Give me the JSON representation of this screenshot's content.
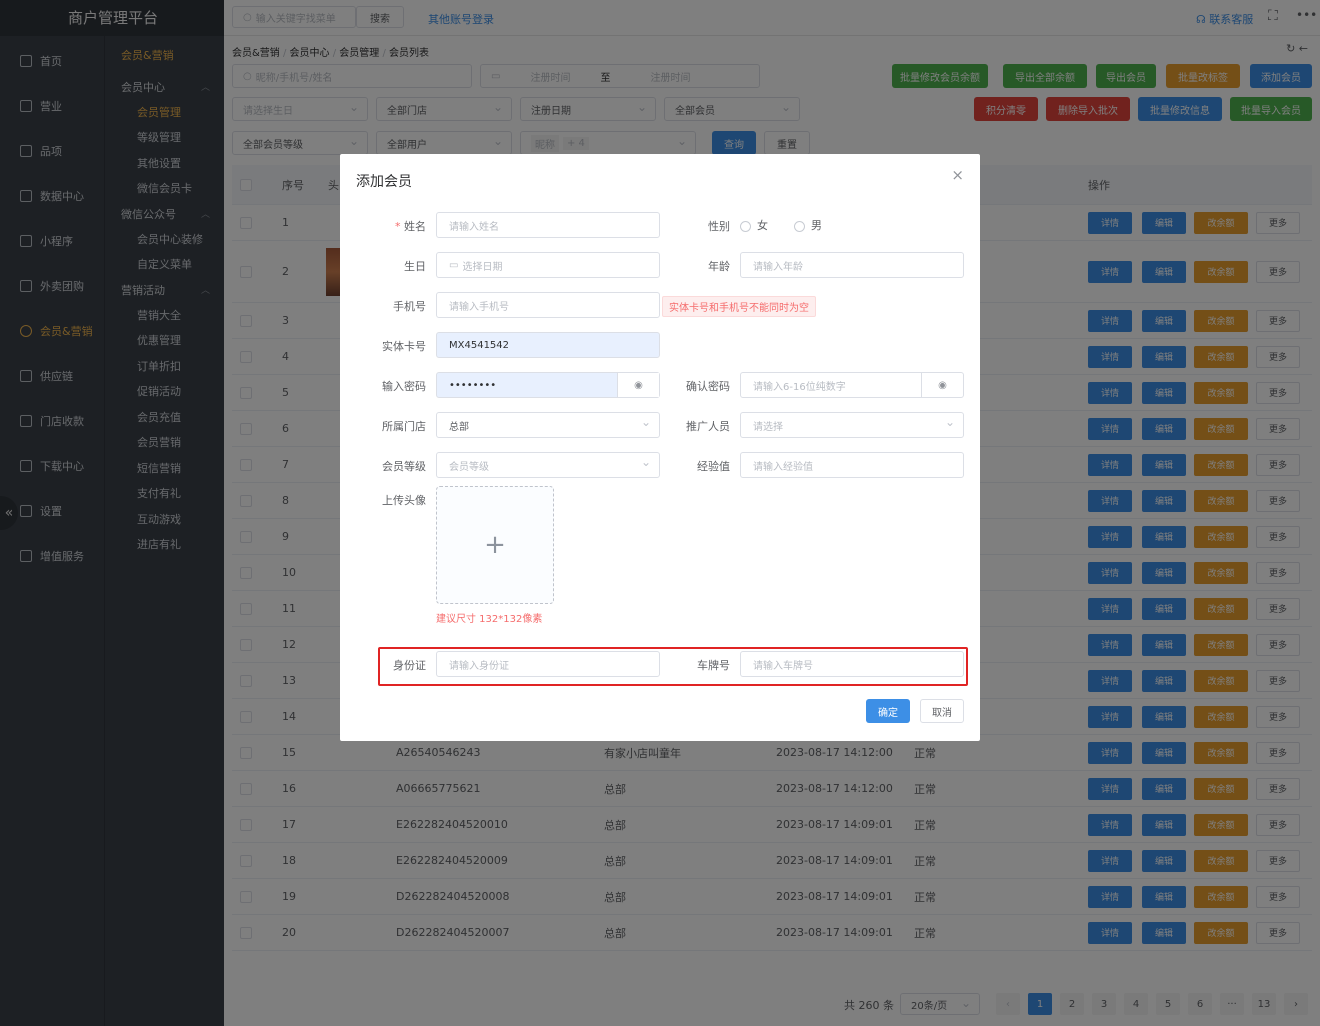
{
  "app": {
    "title": "商户管理平台"
  },
  "topbar": {
    "search_placeholder": "输入关键字找菜单",
    "search_btn": "搜索",
    "other_login": "其他账号登录",
    "contact": "联系客服"
  },
  "sidebar": {
    "items": [
      {
        "label": "首页",
        "icon": "home-icon"
      },
      {
        "label": "营业",
        "icon": "calendar-icon"
      },
      {
        "label": "品项",
        "icon": "bag-icon"
      },
      {
        "label": "数据中心",
        "icon": "share-icon"
      },
      {
        "label": "小程序",
        "icon": "phone-icon"
      },
      {
        "label": "外卖团购",
        "icon": "group-icon"
      },
      {
        "label": "会员&营销",
        "icon": "user-icon",
        "active": true
      },
      {
        "label": "供应链",
        "icon": "truck-icon"
      },
      {
        "label": "门店收款",
        "icon": "database-icon"
      },
      {
        "label": "下载中心",
        "icon": "download-icon"
      },
      {
        "label": "设置",
        "icon": "gear-icon"
      },
      {
        "label": "增值服务",
        "icon": "clock-icon"
      }
    ]
  },
  "subnav": {
    "title": "会员&营销",
    "groups": [
      {
        "label": "会员中心",
        "items": [
          "会员管理",
          "等级管理",
          "其他设置",
          "微信会员卡"
        ]
      },
      {
        "label": "微信公众号",
        "items": [
          "会员中心装修",
          "自定义菜单"
        ]
      },
      {
        "label": "营销活动",
        "items": [
          "营销大全",
          "优惠管理",
          "订单折扣",
          "促销活动",
          "会员充值",
          "会员营销",
          "短信营销",
          "支付有礼",
          "互动游戏",
          "进店有礼"
        ]
      }
    ]
  },
  "breadcrumb": [
    "会员&营销",
    "会员中心",
    "会员管理",
    "会员列表"
  ],
  "filters": {
    "search_placeholder": "昵称/手机号/姓名",
    "date_start": "注册时间",
    "date_sep": "至",
    "date_end": "注册时间",
    "birthday": "请选择生日",
    "store": "全部门店",
    "reg_date": "注册日期",
    "member": "全部会员",
    "level": "全部会员等级",
    "users": "全部用户",
    "nick": "昵称",
    "nick_more": "+ 4",
    "query": "查询",
    "reset": "重置"
  },
  "actions": {
    "row1": [
      "批量修改会员余额",
      "导出全部余额",
      "导出会员",
      "批量改标签",
      "添加会员"
    ],
    "row2": [
      "积分清零",
      "删除导入批次",
      "批量修改信息",
      "批量导入会员"
    ]
  },
  "table": {
    "headers": {
      "index": "序号",
      "avatar": "头",
      "ops": "操作"
    },
    "op_labels": [
      "详情",
      "编辑",
      "改余额",
      "更多"
    ],
    "rows": [
      {
        "i": "1"
      },
      {
        "i": "2"
      },
      {
        "i": "3"
      },
      {
        "i": "4"
      },
      {
        "i": "5"
      },
      {
        "i": "6"
      },
      {
        "i": "7"
      },
      {
        "i": "8"
      },
      {
        "i": "9"
      },
      {
        "i": "10"
      },
      {
        "i": "11"
      },
      {
        "i": "12"
      },
      {
        "i": "13"
      },
      {
        "i": "14"
      },
      {
        "i": "15",
        "card": "A26540546243",
        "store": "有家小店叫童年",
        "time": "2023-08-17 14:12:00",
        "status": "正常"
      },
      {
        "i": "16",
        "card": "A06665775621",
        "store": "总部",
        "time": "2023-08-17 14:12:00",
        "status": "正常"
      },
      {
        "i": "17",
        "card": "E262282404520010",
        "store": "总部",
        "time": "2023-08-17 14:09:01",
        "status": "正常"
      },
      {
        "i": "18",
        "card": "E262282404520009",
        "store": "总部",
        "time": "2023-08-17 14:09:01",
        "status": "正常"
      },
      {
        "i": "19",
        "card": "D262282404520008",
        "store": "总部",
        "time": "2023-08-17 14:09:01",
        "status": "正常"
      },
      {
        "i": "20",
        "card": "D262282404520007",
        "store": "总部",
        "time": "2023-08-17 14:09:01",
        "status": "正常"
      }
    ]
  },
  "pagination": {
    "total": "共 260 条",
    "size": "20条/页",
    "pages": [
      "1",
      "2",
      "3",
      "4",
      "5",
      "6",
      "···",
      "13"
    ],
    "current": "1"
  },
  "modal": {
    "title": "添加会员",
    "name_label": "姓名",
    "name_ph": "请输入姓名",
    "gender_label": "性别",
    "female": "女",
    "male": "男",
    "birthday_label": "生日",
    "birthday_ph": "选择日期",
    "age_label": "年龄",
    "age_ph": "请输入年龄",
    "phone_label": "手机号",
    "phone_ph": "请输入手机号",
    "phone_error": "实体卡号和手机号不能同时为空",
    "card_label": "实体卡号",
    "card_value": "MX4541542",
    "pwd_label": "输入密码",
    "pwd_value": "••••••••",
    "confirm_label": "确认密码",
    "confirm_ph": "请输入6-16位纯数字",
    "store_label": "所属门店",
    "store_value": "总部",
    "promoter_label": "推广人员",
    "promoter_ph": "请选择",
    "level_label": "会员等级",
    "level_ph": "会员等级",
    "exp_label": "经验值",
    "exp_ph": "请输入经验值",
    "avatar_label": "上传头像",
    "avatar_hint": "建议尺寸 132*132像素",
    "id_label": "身份证",
    "id_ph": "请输入身份证",
    "plate_label": "车牌号",
    "plate_ph": "请输入车牌号",
    "ok": "确定",
    "cancel": "取消"
  },
  "colors": {
    "accent": "#3d8fe6",
    "highlight": "#e02424",
    "active_nav": "#f1b54d"
  }
}
